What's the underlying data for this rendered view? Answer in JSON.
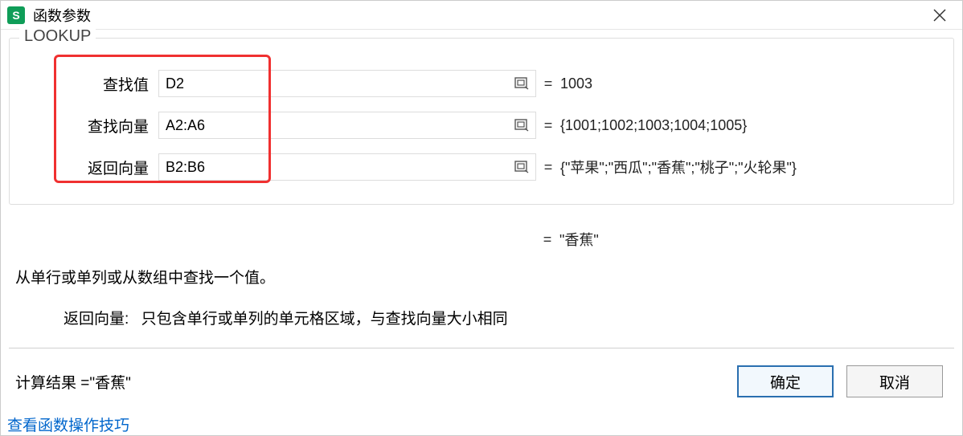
{
  "titlebar": {
    "app_icon_letter": "S",
    "title": "函数参数"
  },
  "fieldset": {
    "legend": "LOOKUP",
    "params": [
      {
        "label": "查找值",
        "value": "D2",
        "result": "1003"
      },
      {
        "label": "查找向量",
        "value": "A2:A6",
        "result": "{1001;1002;1003;1004;1005}"
      },
      {
        "label": "返回向量",
        "value": "B2:B6",
        "result": "{\"苹果\";\"西瓜\";\"香蕉\";\"桃子\";\"火轮果\"}"
      }
    ],
    "formula_result": "\"香蕉\""
  },
  "description": {
    "line1": "从单行或单列或从数组中查找一个值。",
    "param_name": "返回向量:",
    "param_desc": "只包含单行或单列的单元格区域，与查找向量大小相同"
  },
  "footer": {
    "calc_label": "计算结果 = ",
    "calc_value": "\"香蕉\"",
    "help_link": "查看函数操作技巧",
    "ok_label": "确定",
    "cancel_label": "取消"
  }
}
